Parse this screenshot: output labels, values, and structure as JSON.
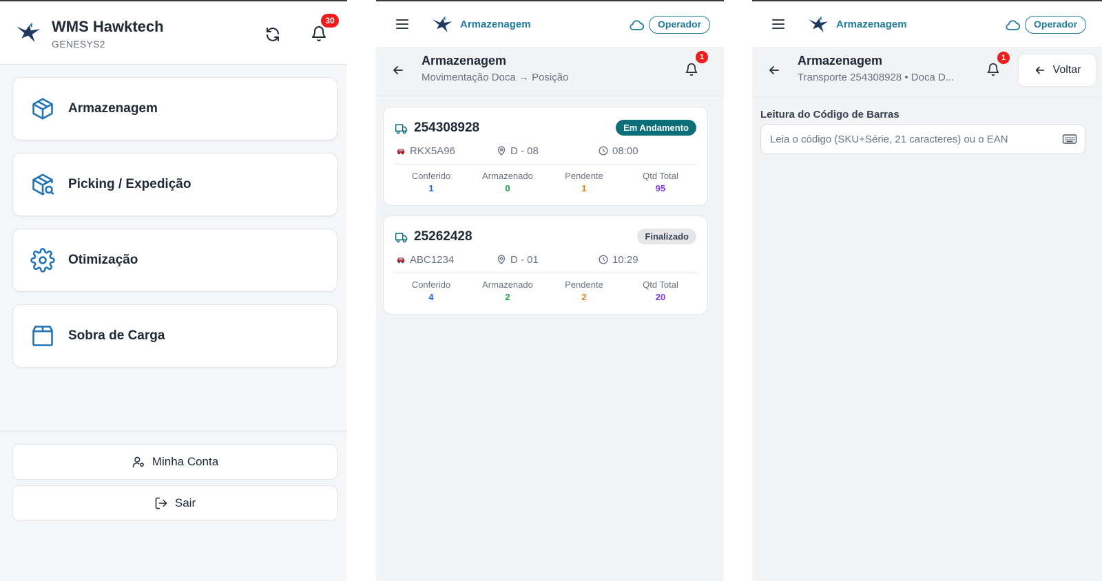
{
  "colors": {
    "brand": "#1f7c9a",
    "icon_blue": "#1e73b8",
    "badge_red": "#ef1c1c",
    "status_active": "#0c6e78",
    "conferido": "#2563eb",
    "armazenado": "#16a34a",
    "pendente": "#ea7a0c",
    "qtd_total": "#7c3aed"
  },
  "home": {
    "app_title": "WMS Hawktech",
    "environment": "GENESYS2",
    "notification_count": "30",
    "icons": {
      "logo": "hawk-logo-icon",
      "refresh": "refresh-icon",
      "bell": "bell-icon"
    },
    "menu": [
      {
        "label": "Armazenagem",
        "icon": "box-icon"
      },
      {
        "label": "Picking / Expedição",
        "icon": "box-search-icon"
      },
      {
        "label": "Otimização",
        "icon": "gear-icon"
      },
      {
        "label": "Sobra de Carga",
        "icon": "package-icon"
      }
    ],
    "footer": {
      "account_label": "Minha Conta",
      "logout_label": "Sair"
    }
  },
  "list_screen": {
    "topbar_title": "Armazenagem",
    "operator_label": "Operador",
    "header_title": "Armazenagem",
    "header_subtitle": "Movimentação Doca → Posição",
    "notification_count": "1",
    "transports": [
      {
        "id": "254308928",
        "status": "Em Andamento",
        "status_kind": "active",
        "plate": "RKX5A96",
        "dock": "D - 08",
        "time": "08:00",
        "stats": [
          {
            "label": "Conferido",
            "value": "1"
          },
          {
            "label": "Armazenado",
            "value": "0"
          },
          {
            "label": "Pendente",
            "value": "1"
          },
          {
            "label": "Qtd Total",
            "value": "95"
          }
        ]
      },
      {
        "id": "25262428",
        "status": "Finalizado",
        "status_kind": "done",
        "plate": "ABC1234",
        "dock": "D - 01",
        "time": "10:29",
        "stats": [
          {
            "label": "Conferido",
            "value": "4"
          },
          {
            "label": "Armazenado",
            "value": "2"
          },
          {
            "label": "Pendente",
            "value": "2"
          },
          {
            "label": "Qtd Total",
            "value": "20"
          }
        ]
      }
    ]
  },
  "scan_screen": {
    "topbar_title": "Armazenagem",
    "operator_label": "Operador",
    "header_title": "Armazenagem",
    "header_subtitle": "Transporte 254308928 • Doca D...",
    "notification_count": "1",
    "back_button_label": "Voltar",
    "barcode_label": "Leitura do Código de Barras",
    "barcode_placeholder": "Leia o código (SKU+Série, 21 caracteres) ou o EAN",
    "barcode_value": ""
  }
}
